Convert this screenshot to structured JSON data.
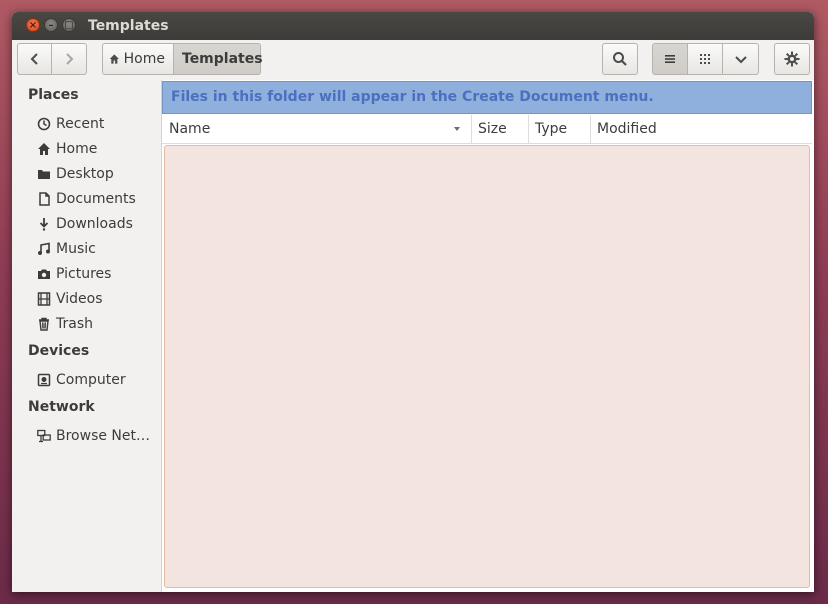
{
  "window": {
    "title": "Templates"
  },
  "titlebar_buttons": {
    "close": "×",
    "minimize": "–",
    "maximize": "□"
  },
  "breadcrumb": {
    "home": "Home",
    "current": "Templates"
  },
  "sidebar": {
    "sections": [
      {
        "heading": "Places",
        "items": [
          {
            "label": "Recent",
            "icon": "recent-icon"
          },
          {
            "label": "Home",
            "icon": "home-icon"
          },
          {
            "label": "Desktop",
            "icon": "folder-icon"
          },
          {
            "label": "Documents",
            "icon": "document-icon"
          },
          {
            "label": "Downloads",
            "icon": "download-icon"
          },
          {
            "label": "Music",
            "icon": "music-icon"
          },
          {
            "label": "Pictures",
            "icon": "camera-icon"
          },
          {
            "label": "Videos",
            "icon": "film-icon"
          },
          {
            "label": "Trash",
            "icon": "trash-icon"
          }
        ]
      },
      {
        "heading": "Devices",
        "items": [
          {
            "label": "Computer",
            "icon": "drive-icon"
          }
        ]
      },
      {
        "heading": "Network",
        "items": [
          {
            "label": "Browse Net…",
            "icon": "network-icon"
          }
        ]
      }
    ]
  },
  "info_bar": {
    "message": "Files in this folder will appear in the Create Document menu."
  },
  "columns": [
    "Name",
    "Size",
    "Type",
    "Modified"
  ],
  "colors": {
    "info_bg": "#8fb0dc",
    "info_text": "#4c6fbf",
    "list_bg": "#f3e4e0"
  }
}
